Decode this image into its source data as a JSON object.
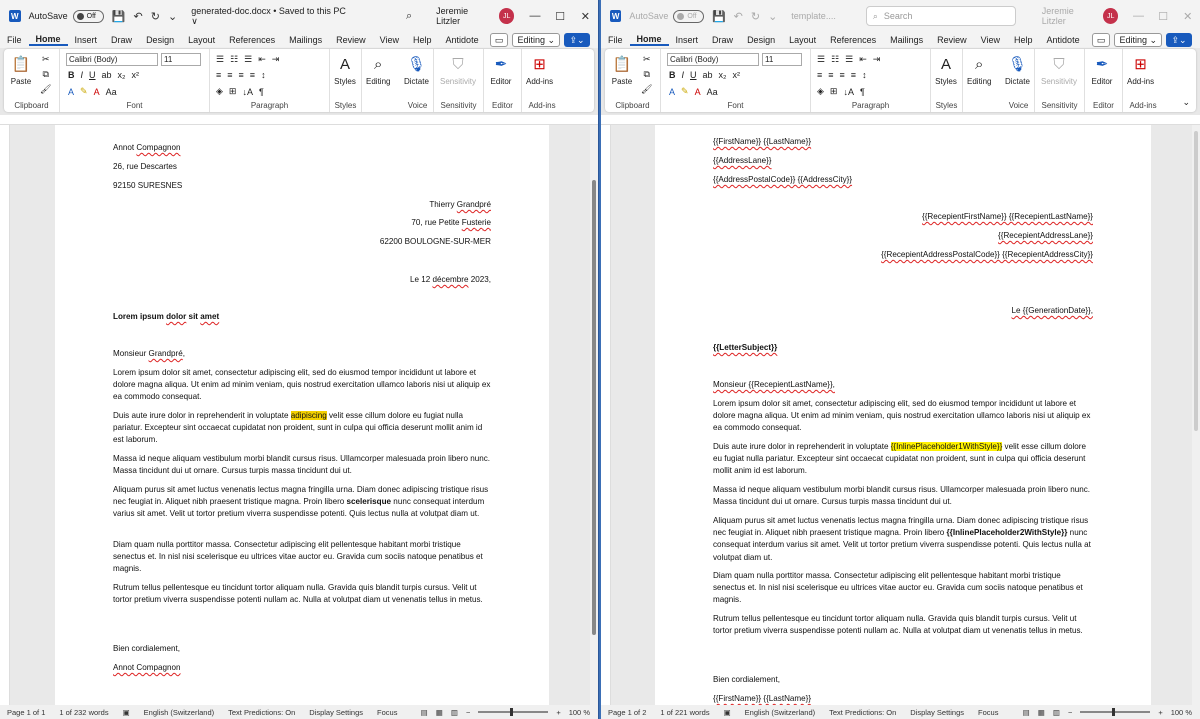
{
  "left": {
    "title": {
      "autosave": "AutoSave",
      "toggle": "Off",
      "doc": "generated-doc.docx • Saved to this PC ∨",
      "user": "Jeremie Litzler",
      "initials": "JL"
    },
    "menu": [
      "File",
      "Home",
      "Insert",
      "Draw",
      "Design",
      "Layout",
      "References",
      "Mailings",
      "Review",
      "View",
      "Help",
      "Antidote"
    ],
    "editing": "Editing ⌄",
    "ribbon": {
      "paste": "Paste",
      "clipboard": "Clipboard",
      "font_name": "Calibri (Body)",
      "font_size": "11",
      "font": "Font",
      "paragraph": "Paragraph",
      "styles": "Styles",
      "styles_group": "Styles",
      "editing": "Editing",
      "dictate": "Dictate",
      "voice": "Voice",
      "sensitivity": "Sensitivity",
      "sensitivity_group": "Sensitivity",
      "editor": "Editor",
      "editor_group": "Editor",
      "addins": "Add-ins",
      "addins_group": "Add-ins"
    },
    "doc": {
      "s1": "Annot ",
      "s1b": "Compagnon",
      "s2": "26, rue Descartes",
      "s3": "92150 SURESNES",
      "r1": "Thierry ",
      "r1b": "Grandpré",
      "r2": "70, rue Petite ",
      "r2b": "Fusterie",
      "r3": "62200 BOULOGNE-SUR-MER",
      "date": "Le 12 ",
      "dateb": "décembre",
      " date2": "",
      "date_end": " 2023,",
      "subject_a": "Lorem ipsum ",
      "subject_b": "dolor",
      " subject_c": "",
      "subject_c": " sit ",
      "subject_d": "amet",
      "greet": "Monsieur ",
      "greetb": "Grandpré",
      ",greet_end": "",
      "greet_end": ",",
      "p1": "Lorem ipsum dolor sit amet, consectetur adipiscing elit, sed do eiusmod tempor incididunt ut labore et dolore magna aliqua. Ut enim ad minim veniam, quis nostrud exercitation ullamco laboris nisi ut aliquip ex ea commodo consequat.",
      "p2a": "Duis aute irure dolor in reprehenderit in voluptate ",
      "p2hl": "adipiscing",
      "p2b": " velit esse cillum dolore eu fugiat nulla pariatur. Excepteur sint occaecat cupidatat non proident, sunt in culpa qui officia deserunt mollit anim id est laborum.",
      "p3": "Massa id neque aliquam vestibulum morbi blandit cursus risus. Ullamcorper malesuada proin libero nunc. Massa tincidunt dui ut ornare. Cursus turpis massa tincidunt dui ut.",
      "p4a": "Aliquam purus sit amet luctus venenatis lectus magna fringilla urna. Diam donec adipiscing tristique risus nec feugiat in. Aliquet nibh praesent tristique magna. Proin libero ",
      "p4b": "scelerisque",
      "p4c": " nunc consequat interdum varius sit amet. Velit ut tortor pretium viverra suspendisse potenti. Quis lectus nulla at volutpat diam ut.",
      "p5": "Diam quam nulla porttitor massa. Consectetur adipiscing elit pellentesque habitant morbi tristique senectus et. In nisl nisi scelerisque eu ultrices vitae auctor eu. Gravida cum sociis natoque penatibus et magnis.",
      "p6": "Rutrum tellus pellentesque eu tincidunt tortor aliquam nulla. Gravida quis blandit turpis cursus. Velit ut tortor pretium viverra suspendisse potenti nullam ac. Nulla at volutpat diam ut venenatis tellus in metus.",
      "close": "Bien cordialement,",
      "sign": "Annot  Compagnon"
    },
    "status": {
      "page": "Page 1 of 1",
      "words": "1 of 232 words",
      "lang": "English (Switzerland)",
      "predict": "Text Predictions: On",
      "display": "Display Settings",
      "focus": "Focus",
      "zoom": "100 %"
    }
  },
  "right": {
    "title": {
      "autosave": "AutoSave",
      "toggle": "Off",
      "doc": "template....",
      "search": "Search",
      "user": "Jeremie Litzler",
      "initials": "JL"
    },
    "menu": [
      "File",
      "Home",
      "Insert",
      "Draw",
      "Design",
      "Layout",
      "References",
      "Mailings",
      "Review",
      "View",
      "Help",
      "Antidote"
    ],
    "editing": "Editing ⌄",
    "doc": {
      "s1": "{{FirstName}} {{LastName}}",
      "s2": "{{AddressLane}}",
      "s3": "{{AddressPostalCode}} {{AddressCity}}",
      "r1": "{{RecepientFirstName}} {{RecepientLastName}}",
      "r2": "{{RecepientAddressLane}}",
      "r3": "{{RecepientAddressPostalCode}} {{RecepientAddressCity}}",
      "date": "Le {{GenerationDate}},",
      "subject": "{{LetterSubject}}",
      "greet": "Monsieur {{RecepientLastName}},",
      "p1": "Lorem ipsum dolor sit amet, consectetur adipiscing elit, sed do eiusmod tempor incididunt ut labore et dolore magna aliqua. Ut enim ad minim veniam, quis nostrud exercitation ullamco laboris nisi ut aliquip ex ea commodo consequat.",
      "p2a": "Duis aute irure dolor in reprehenderit in voluptate ",
      "p2hl": "{{InlinePlaceholder1WithStyle}}",
      "p2b": " velit esse cillum dolore eu fugiat nulla pariatur. Excepteur sint occaecat cupidatat non proident, sunt in culpa qui officia deserunt mollit anim id est laborum.",
      "p3": "Massa id neque aliquam vestibulum morbi blandit cursus risus. Ullamcorper malesuada proin libero nunc. Massa tincidunt dui ut ornare. Cursus turpis massa tincidunt dui ut.",
      "p4a": "Aliquam purus sit amet luctus venenatis lectus magna fringilla urna. Diam donec adipiscing tristique risus nec feugiat in. Aliquet nibh praesent tristique magna. Proin libero ",
      "p4b": "{{InlinePlaceholder2WithStyle}}",
      "p4c": " nunc consequat interdum varius sit amet. Velit ut tortor pretium viverra suspendisse potenti. Quis lectus nulla at volutpat diam ut.",
      "p5": "Diam quam nulla porttitor massa. Consectetur adipiscing elit pellentesque habitant morbi tristique senectus et. In nisl nisi scelerisque eu ultrices vitae auctor eu. Gravida cum sociis natoque penatibus et magnis.",
      "p6": "Rutrum tellus pellentesque eu tincidunt tortor aliquam nulla. Gravida quis blandit turpis cursus. Velit ut tortor pretium viverra suspendisse potenti nullam ac. Nulla at volutpat diam ut venenatis tellus in metus.",
      "close": "Bien cordialement,",
      "sign": "{{FirstName}} {{LastName}}"
    },
    "status": {
      "page": "Page 1 of 2",
      "words": "1 of 221 words",
      "lang": "English (Switzerland)",
      "predict": "Text Predictions: On",
      "display": "Display Settings",
      "focus": "Focus",
      "zoom": "100 %"
    }
  }
}
